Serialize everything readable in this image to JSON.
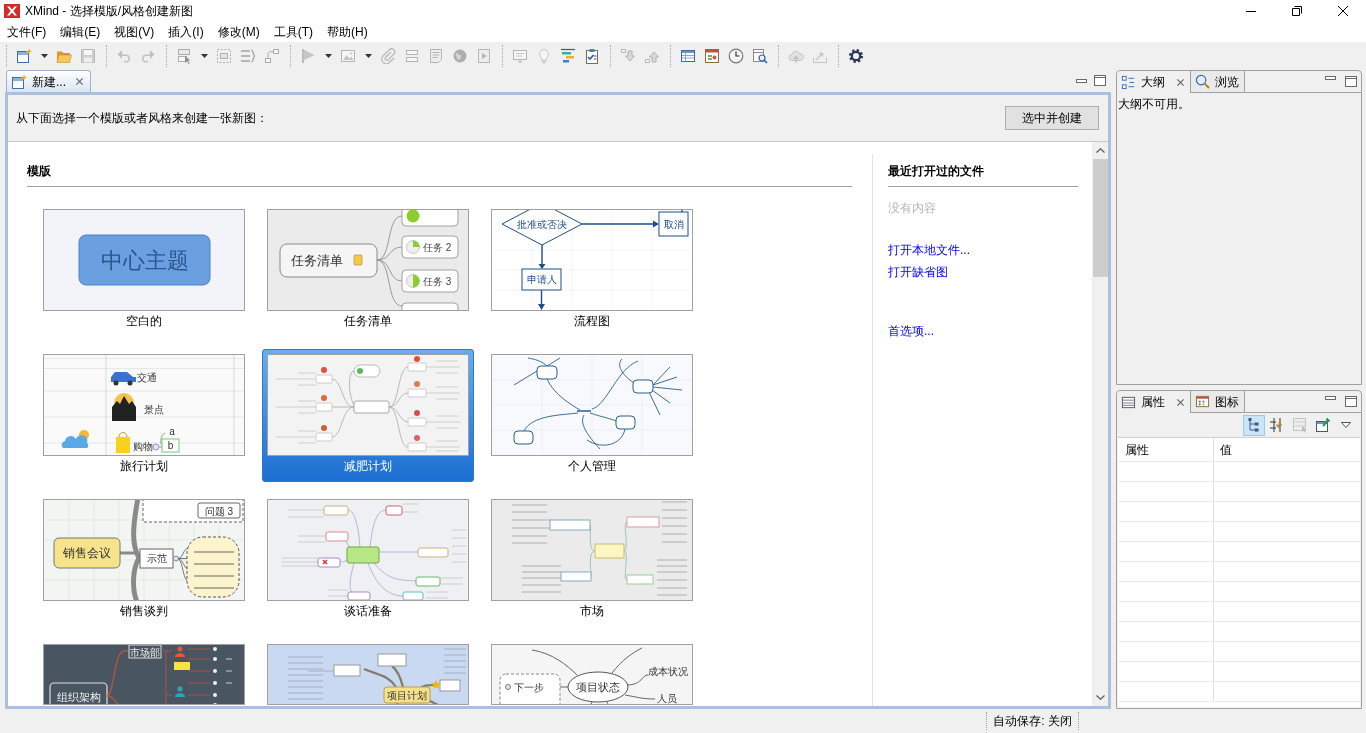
{
  "window": {
    "title": "XMind - 选择模版/风格创建新图"
  },
  "menu": [
    "文件(F)",
    "编辑(E)",
    "视图(V)",
    "插入(I)",
    "修改(M)",
    "工具(T)",
    "帮助(H)"
  ],
  "toolbar": [
    [
      {
        "kind": "newmap",
        "disabled": false,
        "dropdown": true
      },
      {
        "kind": "folder",
        "disabled": false
      },
      {
        "kind": "save",
        "disabled": true
      }
    ],
    [
      {
        "kind": "undo",
        "disabled": true
      },
      {
        "kind": "redo",
        "disabled": true
      }
    ],
    [
      {
        "kind": "topic",
        "disabled": true,
        "dropdown": true
      },
      {
        "kind": "boundary",
        "disabled": true
      },
      {
        "kind": "summary",
        "disabled": true
      },
      {
        "kind": "relationship",
        "disabled": true
      }
    ],
    [
      {
        "kind": "flag",
        "disabled": true,
        "dropdown": true
      },
      {
        "kind": "image",
        "disabled": true,
        "dropdown": true
      },
      {
        "kind": "clip",
        "disabled": true
      },
      {
        "kind": "layout",
        "disabled": true
      },
      {
        "kind": "note",
        "disabled": true
      },
      {
        "kind": "globe",
        "disabled": true
      },
      {
        "kind": "play",
        "disabled": true
      }
    ],
    [
      {
        "kind": "monitor",
        "disabled": true
      },
      {
        "kind": "bulb",
        "disabled": true
      },
      {
        "kind": "gantt",
        "disabled": false
      },
      {
        "kind": "tasks",
        "disabled": false
      }
    ],
    [
      {
        "kind": "drilldown",
        "disabled": true
      },
      {
        "kind": "drillup",
        "disabled": true
      }
    ],
    [
      {
        "kind": "table",
        "disabled": false
      },
      {
        "kind": "chart",
        "disabled": false
      },
      {
        "kind": "clock",
        "disabled": false
      },
      {
        "kind": "magnifier",
        "disabled": false
      }
    ],
    [
      {
        "kind": "cloud",
        "disabled": true
      },
      {
        "kind": "export",
        "disabled": true
      }
    ],
    [
      {
        "kind": "gear",
        "disabled": false
      }
    ]
  ],
  "editor": {
    "tabs": [
      {
        "label": "新建...",
        "kind": "newmap",
        "selected": true
      }
    ],
    "prompt": "从下面选择一个模版或者风格来创建一张新图：",
    "create_button": "选中并创建",
    "templates_heading": "模版",
    "templates": [
      {
        "kind": "blank",
        "label": "空白的",
        "selected": false,
        "preview_texts": [
          "中心主题"
        ]
      },
      {
        "kind": "tasks",
        "label": "任务清单",
        "selected": false,
        "preview_texts": [
          "任务 2",
          "任务清单",
          "任务 3"
        ]
      },
      {
        "kind": "flow",
        "label": "流程图",
        "selected": false,
        "preview_texts": [
          "批准或否决",
          "取消",
          "申请人"
        ]
      },
      {
        "kind": "travel",
        "label": "旅行计划",
        "selected": false,
        "preview_texts": [
          "交通",
          "景点",
          "a",
          "购物",
          "b"
        ]
      },
      {
        "kind": "diet",
        "label": "减肥计划",
        "selected": true
      },
      {
        "kind": "personal",
        "label": "个人管理",
        "selected": false
      },
      {
        "kind": "sales",
        "label": "销售谈判",
        "selected": false,
        "preview_texts": [
          "问题 3",
          "销售会议",
          "示范"
        ]
      },
      {
        "kind": "talk",
        "label": "谈话准备",
        "selected": false
      },
      {
        "kind": "market",
        "label": "市场",
        "selected": false
      },
      {
        "kind": "org",
        "selected": false,
        "preview_texts": [
          "市场部",
          "组织架构"
        ]
      },
      {
        "kind": "plan",
        "selected": false,
        "preview_texts": [
          "项目计划"
        ]
      },
      {
        "kind": "status",
        "selected": false,
        "preview_texts": [
          "成本状况",
          "下一步",
          "项目状态",
          "人员"
        ]
      }
    ],
    "recent": {
      "heading": "最近打开过的文件",
      "empty": "没有内容",
      "links": [
        "打开本地文件...",
        "打开缺省图"
      ],
      "preferences": "首选项..."
    }
  },
  "outline_panel": {
    "tabs": [
      {
        "label": "大纲",
        "kind": "outline",
        "selected": true
      },
      {
        "label": "浏览",
        "kind": "overview",
        "selected": false
      }
    ],
    "message": "大纲不可用。"
  },
  "properties_panel": {
    "tabs": [
      {
        "label": "属性",
        "kind": "properties",
        "selected": true
      },
      {
        "label": "图标",
        "kind": "markers",
        "selected": false
      }
    ],
    "toolbar": [
      {
        "kind": "tree",
        "selected": true,
        "disabled": false
      },
      {
        "kind": "arrows",
        "selected": false,
        "disabled": false
      },
      {
        "kind": "grid",
        "selected": false,
        "disabled": true
      },
      {
        "kind": "pin",
        "selected": false,
        "disabled": false
      }
    ],
    "columns": [
      "属性",
      "值"
    ]
  },
  "status_bar": {
    "autosave": "自动保存: 关闭"
  }
}
